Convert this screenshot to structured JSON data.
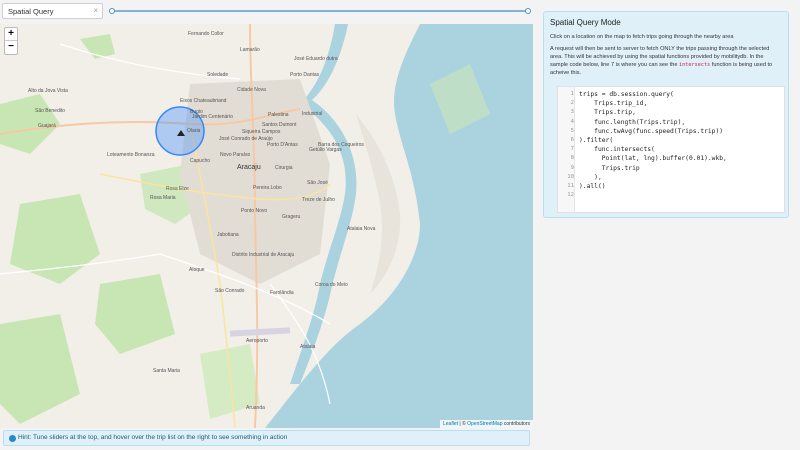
{
  "topbar": {
    "mode_select_value": "Spatial Query",
    "clear_symbol": "×"
  },
  "map": {
    "zoom_in": "+",
    "zoom_out": "−",
    "attribution_leaflet": "Leaflet",
    "attribution_sep": " | © ",
    "attribution_osm": "OpenStreetMap",
    "attribution_tail": " contributors",
    "labels": [
      "Fernando Collor",
      "Soledade",
      "Cidade Nova",
      "Lamarão",
      "José Eduardo dutra",
      "Porto Dantas",
      "Bugio",
      "Alto da Jova Vista",
      "São Benedito",
      "Guajará",
      "Jardim Centenário",
      "Olaria",
      "Palestina",
      "Industrial",
      "Santos Dumont",
      "Porto D'Antas",
      "Siqueira Campos",
      "José Conrado de Araújo",
      "Novo Paraíso",
      "Cirurgia",
      "Getúlio Vargas",
      "Barra dos Coqueiros",
      "Loteamento Bonanza",
      "Capucho",
      "Aracaju",
      "São José",
      "Rosa Elze",
      "Pereira Lobo",
      "Ponto Novo",
      "Treze de Julho",
      "Grageru",
      "Jabotiana",
      "Atalaia Nova",
      "Aloque",
      "Distrito Industrial de Aracaju",
      "São Conrado",
      "Farolândia",
      "Coroa do Meio",
      "Aeroporto",
      "Atalaia",
      "Santa Maria",
      "Aruanda",
      "Rosa Maria",
      "Eixos Chateaubriand"
    ]
  },
  "hint": {
    "text": "Hint: Tune sliders at the top, and hover over the trip list on the right to see something in action"
  },
  "panel": {
    "title": "Spatial Query Mode",
    "intro": "Click on a location on the map to fetch trips going through the nearby area",
    "description_before": "A request will then be sent to server to fetch ONLY the trips passing through the selected area. This will be achieved by using the spatial functions provided by mobilitydb. In the sample code below, line 7 is where you can see the ",
    "description_code": "intersects",
    "description_after": " function is being used to acheive this.",
    "code_lines": [
      "trips = db.session.query(",
      "    Trips.trip_id,",
      "    Trips.trip,",
      "    func.length(Trips.trip),",
      "    func.twAvg(func.speed(Trips.trip))",
      ").filter(",
      "    func.intersects(",
      "      Point(lat, lng).buffer(0.01).wkb,",
      "      Trips.trip",
      "    ),",
      ").all()"
    ],
    "line_numbers": [
      "1",
      "2",
      "3",
      "4",
      "5",
      "6",
      "7",
      "8",
      "9",
      "10",
      "11",
      "12"
    ]
  },
  "colors": {
    "water": "#aad3df",
    "land": "#f2efe9",
    "park": "#c8e6b4",
    "selection_circle": "#3388ff"
  }
}
